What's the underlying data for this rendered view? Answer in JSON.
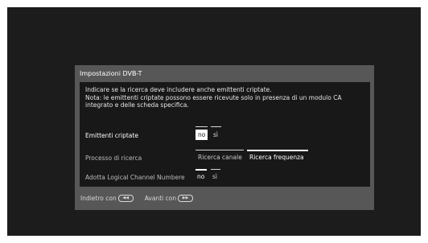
{
  "dialog": {
    "title": "Impostazioni DVB-T",
    "description": [
      "Indicare se la ricerca deve includere anche emittenti criptate.",
      "Nota: le emittenti criptate possono essere ricevute solo in presenza di un modulo CA",
      "integrato e delle scheda specifica."
    ],
    "rows": [
      {
        "label": "Emittenti criptate",
        "options": [
          "no",
          "sì"
        ],
        "selected": "no"
      },
      {
        "label": "Processo di ricerca",
        "options": [
          "Ricerca canale",
          "Ricerca frequenza"
        ],
        "selected": "Ricerca frequenza"
      },
      {
        "label": "Adotta Logical Channel Numbere",
        "options": [
          "no",
          "sì"
        ],
        "selected": "no"
      }
    ],
    "footer": {
      "back_label": "Indietro con",
      "back_icon": "rewind-button-icon",
      "forward_label": "Avanti con",
      "forward_icon": "fast-forward-button-icon"
    }
  },
  "colors": {
    "screen": "#1c1c1c",
    "dialog": "#575757",
    "content": "#181818",
    "highlight": "#ffffff"
  }
}
